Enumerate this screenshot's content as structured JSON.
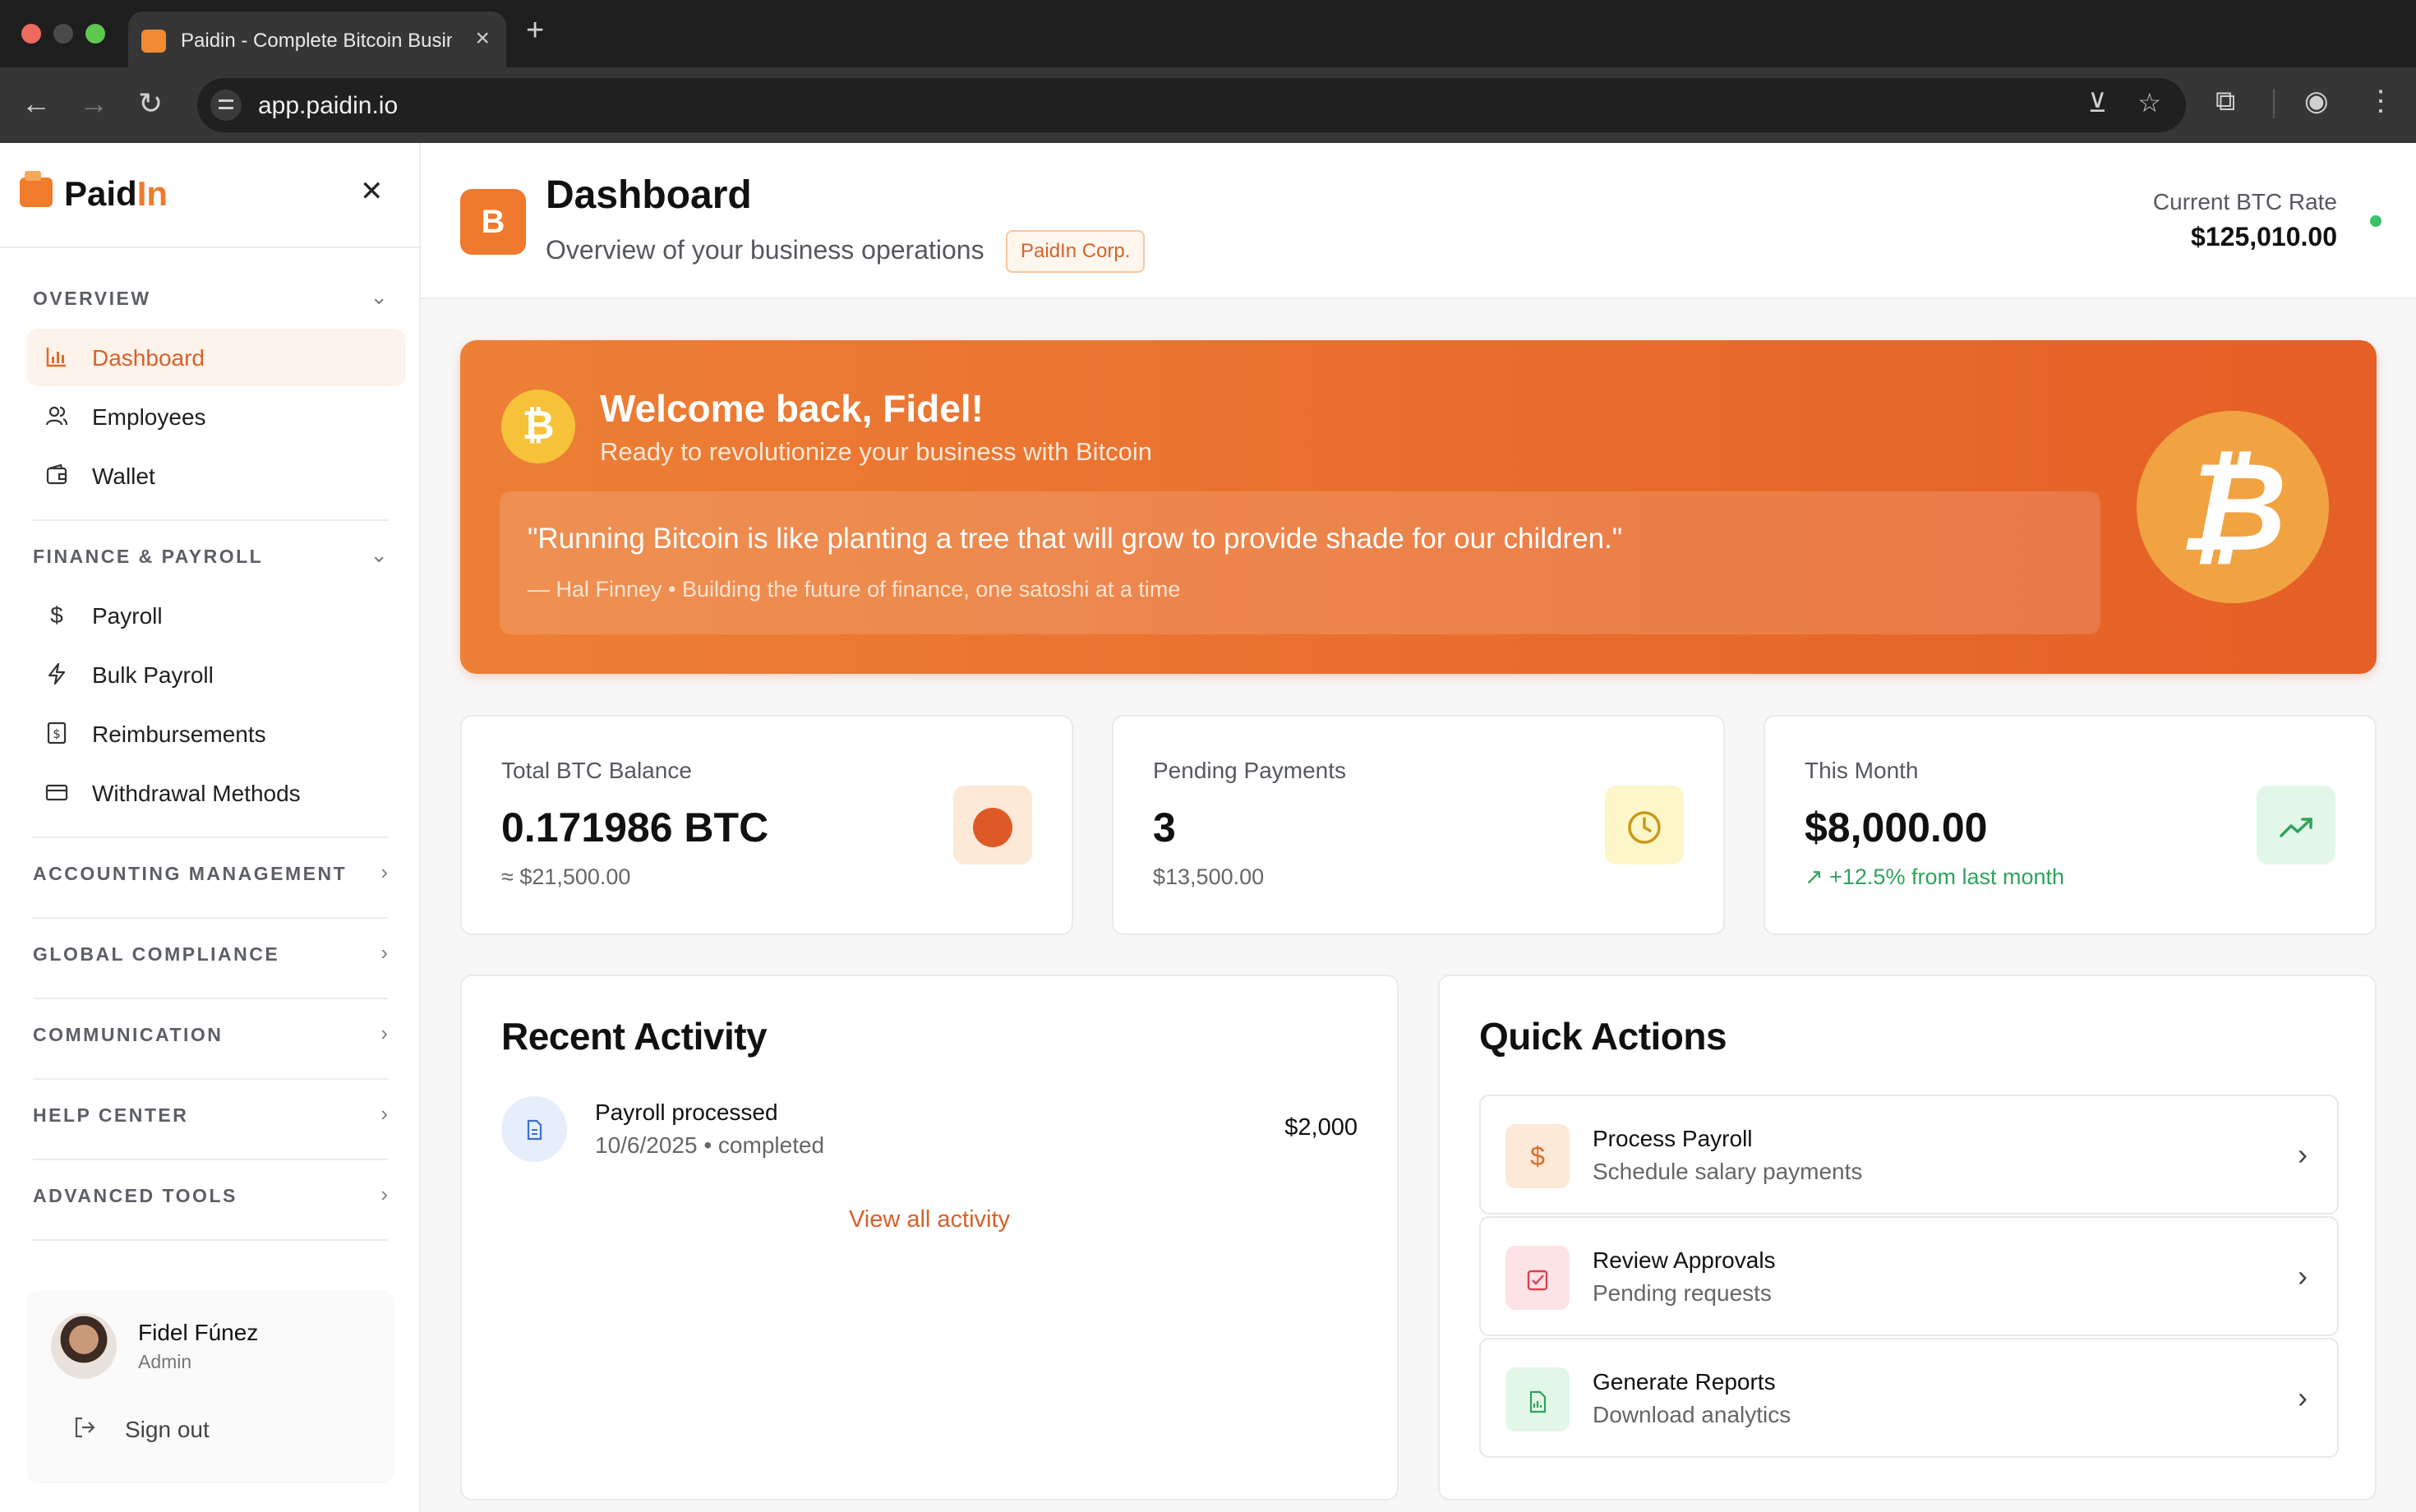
{
  "browser": {
    "tab_title": "Paidin - Complete Bitcoin Business",
    "url": "app.paidin.io"
  },
  "sidebar": {
    "brand": {
      "prefix": "Paid",
      "accent": "In"
    },
    "sections": [
      {
        "title": "OVERVIEW",
        "expanded": true,
        "items": [
          {
            "label": "Dashboard",
            "icon": "bar-chart-icon",
            "active": true
          },
          {
            "label": "Employees",
            "icon": "users-icon"
          },
          {
            "label": "Wallet",
            "icon": "wallet-icon"
          }
        ]
      },
      {
        "title": "FINANCE & PAYROLL",
        "expanded": true,
        "items": [
          {
            "label": "Payroll",
            "icon": "dollar-icon"
          },
          {
            "label": "Bulk Payroll",
            "icon": "lightning-icon"
          },
          {
            "label": "Reimbursements",
            "icon": "receipt-icon"
          },
          {
            "label": "Withdrawal Methods",
            "icon": "credit-card-icon"
          }
        ]
      },
      {
        "title": "ACCOUNTING MANAGEMENT",
        "expanded": false
      },
      {
        "title": "GLOBAL COMPLIANCE",
        "expanded": false
      },
      {
        "title": "COMMUNICATION",
        "expanded": false
      },
      {
        "title": "HELP CENTER",
        "expanded": false
      },
      {
        "title": "ADVANCED TOOLS",
        "expanded": false
      }
    ],
    "user": {
      "name": "Fidel Fúnez",
      "role": "Admin",
      "signout": "Sign out"
    }
  },
  "header": {
    "badge": "B",
    "title": "Dashboard",
    "subtitle": "Overview of your business operations",
    "org": "PaidIn Corp.",
    "rate_label": "Current BTC Rate",
    "rate_value": "$125,010.00",
    "rate_status_color": "#3bc16c"
  },
  "banner": {
    "title": "Welcome back, Fidel!",
    "subtitle": "Ready to revolutionize your business with Bitcoin",
    "quote": "\"Running Bitcoin is like planting a tree that will grow to provide shade for our children.\"",
    "author": "— Hal Finney • Building the future of finance, one satoshi at a time",
    "colors": {
      "start": "#ed7f36",
      "end": "#e55f26"
    }
  },
  "stats": [
    {
      "label": "Total BTC Balance",
      "value": "0.171986 BTC",
      "sub": "≈ $21,500.00",
      "icon": "bitcoin-dot-icon"
    },
    {
      "label": "Pending Payments",
      "value": "3",
      "sub": "$13,500.00",
      "icon": "clock-icon"
    },
    {
      "label": "This Month",
      "value": "$8,000.00",
      "sub": "↗ +12.5% from last month",
      "icon": "trending-up-icon"
    }
  ],
  "recent_activity": {
    "title": "Recent Activity",
    "items": [
      {
        "name": "Payroll processed",
        "meta": "10/6/2025 • completed",
        "amount": "$2,000",
        "icon": "document-icon"
      }
    ],
    "view_all": "View all activity"
  },
  "quick_actions": {
    "title": "Quick Actions",
    "items": [
      {
        "title": "Process Payroll",
        "sub": "Schedule salary payments",
        "icon": "dollar-icon"
      },
      {
        "title": "Review Approvals",
        "sub": "Pending requests",
        "icon": "check-square-icon"
      },
      {
        "title": "Generate Reports",
        "sub": "Download analytics",
        "icon": "report-icon"
      }
    ]
  }
}
